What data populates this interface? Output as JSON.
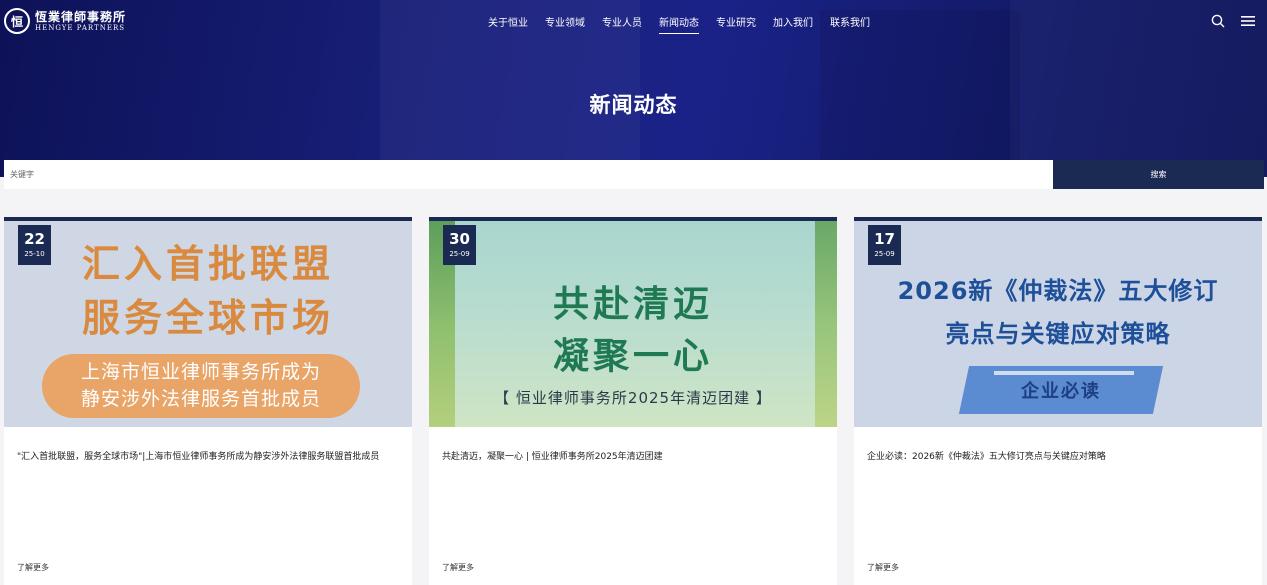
{
  "brand": {
    "mark": "恒",
    "name_cn": "恆業律師事務所",
    "name_en": "HENGYE PARTNERS"
  },
  "nav": {
    "items": [
      "关于恒业",
      "专业领域",
      "专业人员",
      "新闻动态",
      "专业研究",
      "加入我们",
      "联系我们"
    ],
    "active_index": 3
  },
  "icons": {
    "search": "search-icon",
    "menu": "hamburger-menu-icon"
  },
  "hero": {
    "title": "新闻动态"
  },
  "search": {
    "placeholder": "关键字",
    "button_label": "搜索"
  },
  "colors": {
    "accent": "#1b2a52",
    "hero": "#141c6e"
  },
  "cards": [
    {
      "day": "22",
      "year_month": "25-10",
      "image_lines": [
        "汇入首批联盟",
        "服务全球市场",
        "上海市恒业律师事务所成为",
        "静安涉外法律服务首批成员"
      ],
      "title": "\"汇入首批联盟，服务全球市场\"|上海市恒业律师事务所成为静安涉外法律服务联盟首批成员",
      "more": "了解更多"
    },
    {
      "day": "30",
      "year_month": "25-09",
      "image_lines": [
        "共赴清迈",
        "凝聚一心",
        "【 恒业律师事务所2025年清迈团建 】"
      ],
      "title": "共赴清迈，凝聚一心 | 恒业律师事务所2025年清迈团建",
      "more": "了解更多"
    },
    {
      "day": "17",
      "year_month": "25-09",
      "image_lines": [
        "2026新《仲裁法》五大修订",
        "亮点与关键应对策略",
        "企业必读"
      ],
      "title": "企业必读：2026新《仲裁法》五大修订亮点与关键应对策略",
      "more": "了解更多"
    }
  ]
}
